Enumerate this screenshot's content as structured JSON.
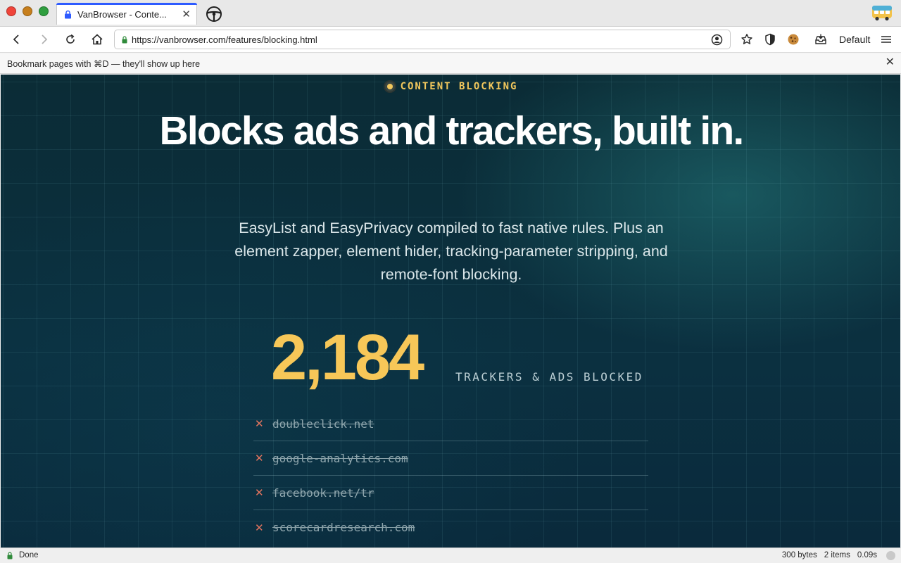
{
  "window": {
    "traffic_lights": [
      "close",
      "minimize",
      "maximize"
    ]
  },
  "tab": {
    "title": "VanBrowser - Conte...",
    "close_glyph": "✕"
  },
  "toolbar": {
    "url": "https://vanbrowser.com/features/blocking.html",
    "profile_label": "Default"
  },
  "bookmarks_bar": {
    "hint": "Bookmark pages with ⌘D — they'll show up here",
    "close_glyph": "✕"
  },
  "page": {
    "eyebrow": "CONTENT BLOCKING",
    "headline": "Blocks ads and trackers, built in.",
    "subhead": "EasyList and EasyPrivacy compiled to fast native rules. Plus an element zapper, element hider, tracking-parameter stripping, and remote-font blocking.",
    "stat_number": "2,184",
    "stat_label": "TRACKERS & ADS BLOCKED",
    "blocked_domains": [
      "doubleclick.net",
      "google-analytics.com",
      "facebook.net/tr",
      "scorecardresearch.com"
    ],
    "blocked_glyph": "✕"
  },
  "statusbar": {
    "status": "Done",
    "size": "300 bytes",
    "items": "2 items",
    "time": "0.09s"
  },
  "colors": {
    "accent_yellow": "#f7c758",
    "x_mark": "#e4755f",
    "tab_accent": "#2e5bff",
    "secure_lock": "#2f8a3a"
  }
}
